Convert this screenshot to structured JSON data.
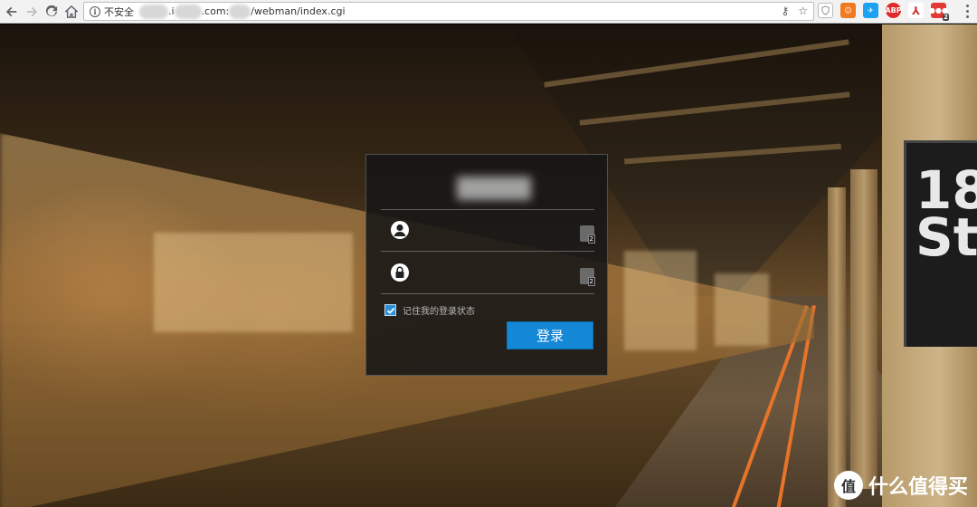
{
  "browser": {
    "security_label": "不安全",
    "url_parts": [
      ".i",
      ".com:",
      "/webman/index.cgi"
    ],
    "extensions": [
      {
        "name": "shield-ext-icon",
        "color": "#ffffff",
        "text": ""
      },
      {
        "name": "orange-ext-icon",
        "color": "#f07a20",
        "text": ""
      },
      {
        "name": "twitter-ext-icon",
        "color": "#1da1f2",
        "text": ""
      },
      {
        "name": "adblock-ext-icon",
        "color": "#e0292b",
        "text": "ABP"
      },
      {
        "name": "pdf-ext-icon",
        "color": "#d32f2f",
        "text": ""
      },
      {
        "name": "red-badge-ext-icon",
        "color": "#e53935",
        "text": "",
        "badge": "2"
      }
    ]
  },
  "login": {
    "username_value": "",
    "password_value": "",
    "pw_manager_badge": "2",
    "remember_label": "记住我的登录状态",
    "remember_checked": true,
    "login_button": "登录"
  },
  "scene": {
    "station_sign": [
      "18",
      "St"
    ],
    "watermark_logo": "值",
    "watermark_text": "什么值得买"
  },
  "colors": {
    "accent": "#1487d6",
    "checkbox": "#2c8fd6",
    "platform_stripe": "#e8742a"
  }
}
